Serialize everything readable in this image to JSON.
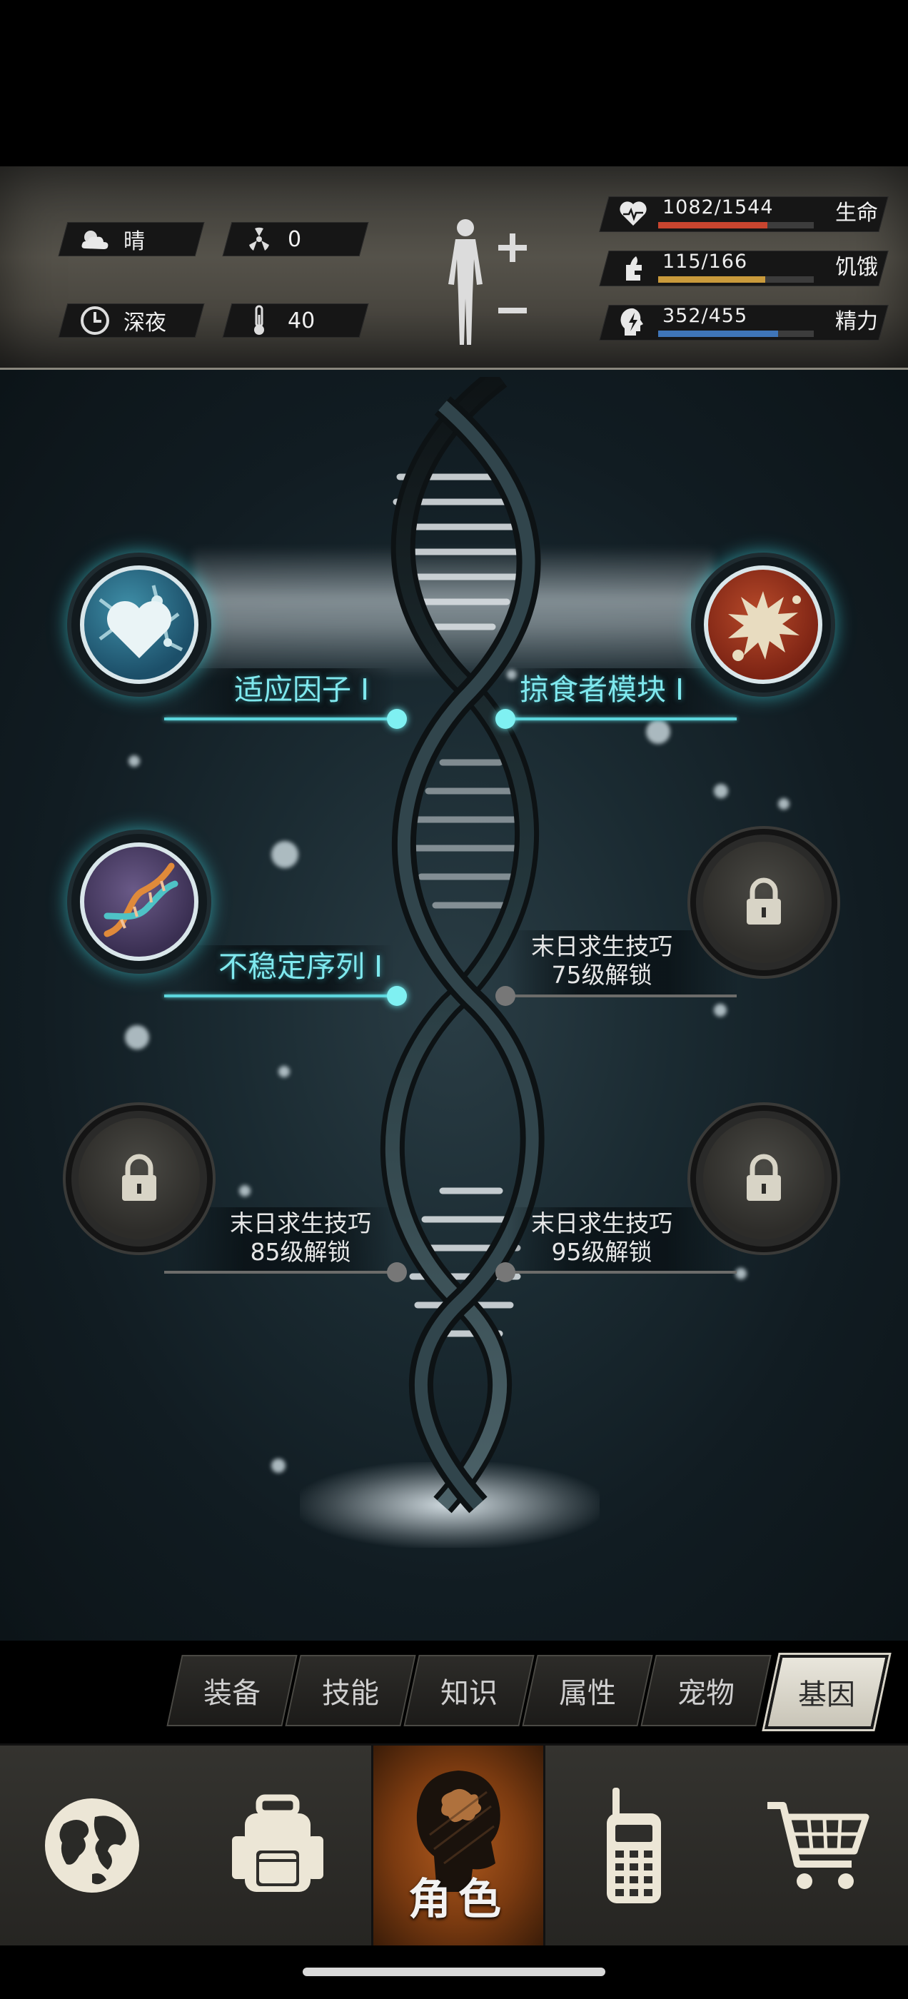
{
  "environment": {
    "weather": "晴",
    "radiation": "0",
    "time_of_day": "深夜",
    "temperature": "40"
  },
  "stats": [
    {
      "name": "生命",
      "value": "1082/1544",
      "fill": 0.7,
      "color": "#c8452f",
      "icon": "heart-icon"
    },
    {
      "name": "饥饿",
      "value": "115/166",
      "fill": 0.69,
      "color": "#c99a3c",
      "icon": "hunger-icon"
    },
    {
      "name": "精力",
      "value": "352/455",
      "fill": 0.77,
      "color": "#3f75b8",
      "icon": "energy-icon"
    }
  ],
  "genes": {
    "adapt_factor": {
      "label": "适应因子 I",
      "icon": "heart-molecule-icon"
    },
    "predator_module": {
      "label": "掠食者模块 I",
      "icon": "virus-icon"
    },
    "unstable_sequence": {
      "label": "不稳定序列 I",
      "icon": "dna-icon"
    },
    "locked_75": {
      "title": "末日求生技巧",
      "unlock": "75级解锁"
    },
    "locked_85": {
      "title": "末日求生技巧",
      "unlock": "85级解锁"
    },
    "locked_95": {
      "title": "末日求生技巧",
      "unlock": "95级解锁"
    }
  },
  "sub_tabs": [
    "装备",
    "技能",
    "知识",
    "属性",
    "宠物",
    "基因"
  ],
  "active_sub_tab": "基因",
  "bottom_nav": {
    "items": [
      "globe-icon",
      "backpack-icon",
      "character-icon",
      "radio-icon",
      "cart-icon"
    ],
    "active_label": "角色"
  }
}
